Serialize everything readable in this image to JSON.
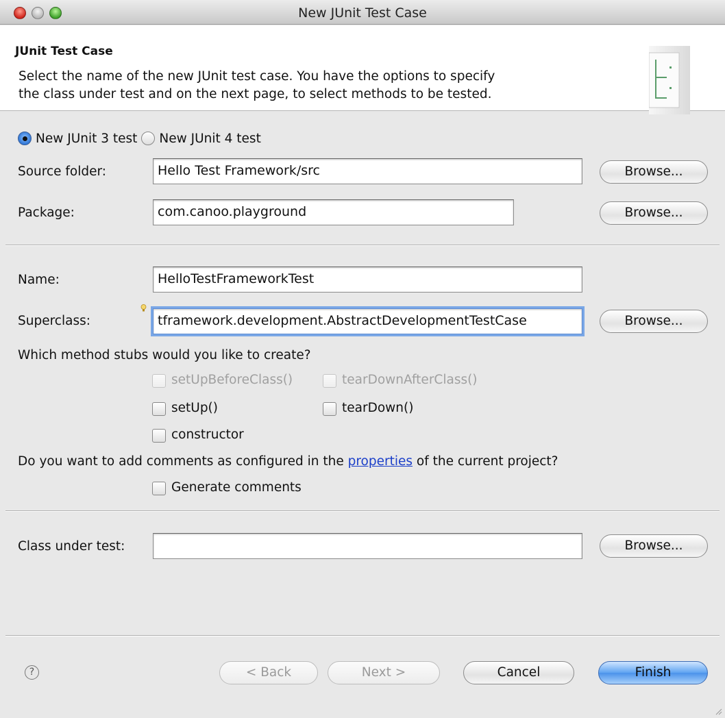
{
  "window": {
    "title": "New JUnit Test Case"
  },
  "header": {
    "title": "JUnit Test Case",
    "description_line1": "Select the name of the new JUnit test case. You have the options to specify",
    "description_line2": "the class under test and on the next page, to select methods to be tested.",
    "icon": "junit-wizard-icon"
  },
  "version": {
    "options": [
      {
        "label": "New JUnit 3 test",
        "checked": true
      },
      {
        "label": "New JUnit 4 test",
        "checked": false
      }
    ]
  },
  "source_folder": {
    "label": "Source folder:",
    "value": "Hello Test Framework/src",
    "browse": "Browse..."
  },
  "package": {
    "label": "Package:",
    "value": "com.canoo.playground",
    "browse": "Browse..."
  },
  "name": {
    "label": "Name:",
    "value": "HelloTestFrameworkTest"
  },
  "superclass": {
    "label": "Superclass:",
    "value": "tframework.development.AbstractDevelopmentTestCase",
    "browse": "Browse..."
  },
  "stubs": {
    "question": "Which method stubs would you like to create?",
    "set_up_before_class": "setUpBeforeClass()",
    "tear_down_after_class": "tearDownAfterClass()",
    "set_up": "setUp()",
    "tear_down": "tearDown()",
    "constructor": "constructor"
  },
  "comments": {
    "question_before": "Do you want to add comments as configured in the ",
    "link": "properties",
    "question_after": " of the current project?",
    "generate": "Generate comments"
  },
  "class_under_test": {
    "label": "Class under test:",
    "value": "",
    "browse": "Browse..."
  },
  "footer": {
    "help": "?",
    "back": "< Back",
    "next": "Next >",
    "cancel": "Cancel",
    "finish": "Finish"
  },
  "colors": {
    "default_button": "#4a92ea",
    "focus_ring": "#7aa7e6",
    "link": "#1b3fc9"
  }
}
